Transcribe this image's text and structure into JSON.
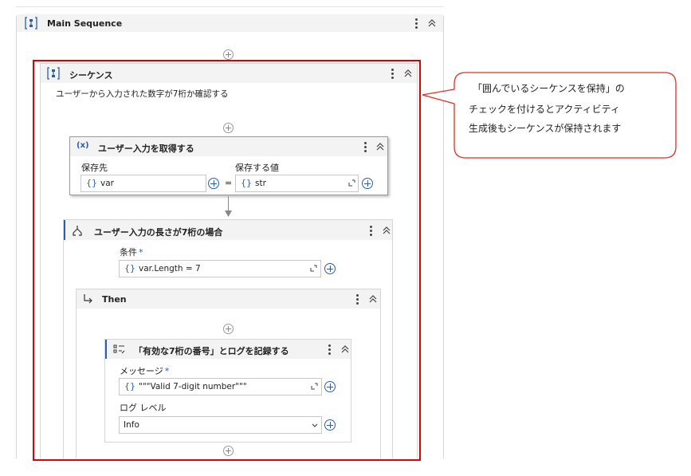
{
  "main_sequence": {
    "title": "Main Sequence"
  },
  "sequence": {
    "title": "シーケンス",
    "annotation": "ユーザーから入力された数字が7桁か確認する"
  },
  "input_activity": {
    "icon": "(x)",
    "title": "ユーザー入力を取得する",
    "save_to_label": "保存先",
    "save_to_value": "var",
    "value_label": "保存する値",
    "value_value": "str",
    "equals": "="
  },
  "if_activity": {
    "title": "ユーザー入力の長さが7桁の場合",
    "condition_label": "条件",
    "required_mark": "*",
    "condition_value": "var.Length = 7"
  },
  "then_block": {
    "title": "Then"
  },
  "log_activity": {
    "title": "「有効な7桁の番号」とログを記録する",
    "message_label": "メッセージ",
    "required_mark": "*",
    "message_value": "\"\"\"Valid 7-digit number\"\"\"",
    "log_level_label": "ログ レベル",
    "log_level_value": "Info"
  },
  "common": {
    "curly": "{}"
  },
  "callout": {
    "lines": [
      "「囲んでいるシーケンスを保持」の",
      "チェックを付けるとアクティビティ",
      "生成後もシーケンスが保持されます"
    ]
  },
  "colors": {
    "highlight_border": "#e00000",
    "accent_blue": "#2c5ea8",
    "header_bg": "#f3f3f3",
    "callout_border": "#d9312b"
  }
}
